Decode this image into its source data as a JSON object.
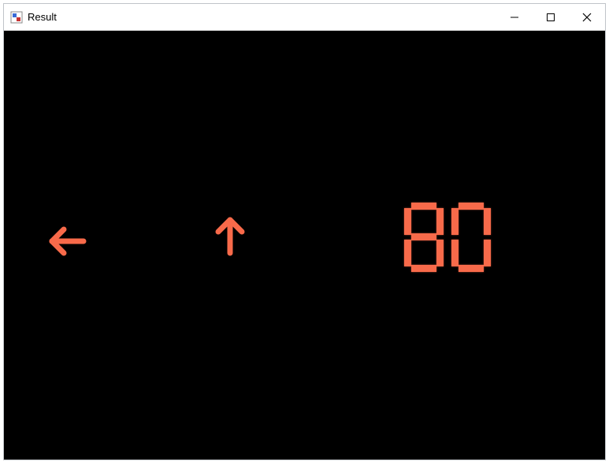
{
  "window": {
    "title": "Result"
  },
  "display": {
    "value": "80",
    "arrow_left_name": "arrow-left-icon",
    "arrow_up_name": "arrow-up-icon",
    "color": "#f86a4a"
  }
}
